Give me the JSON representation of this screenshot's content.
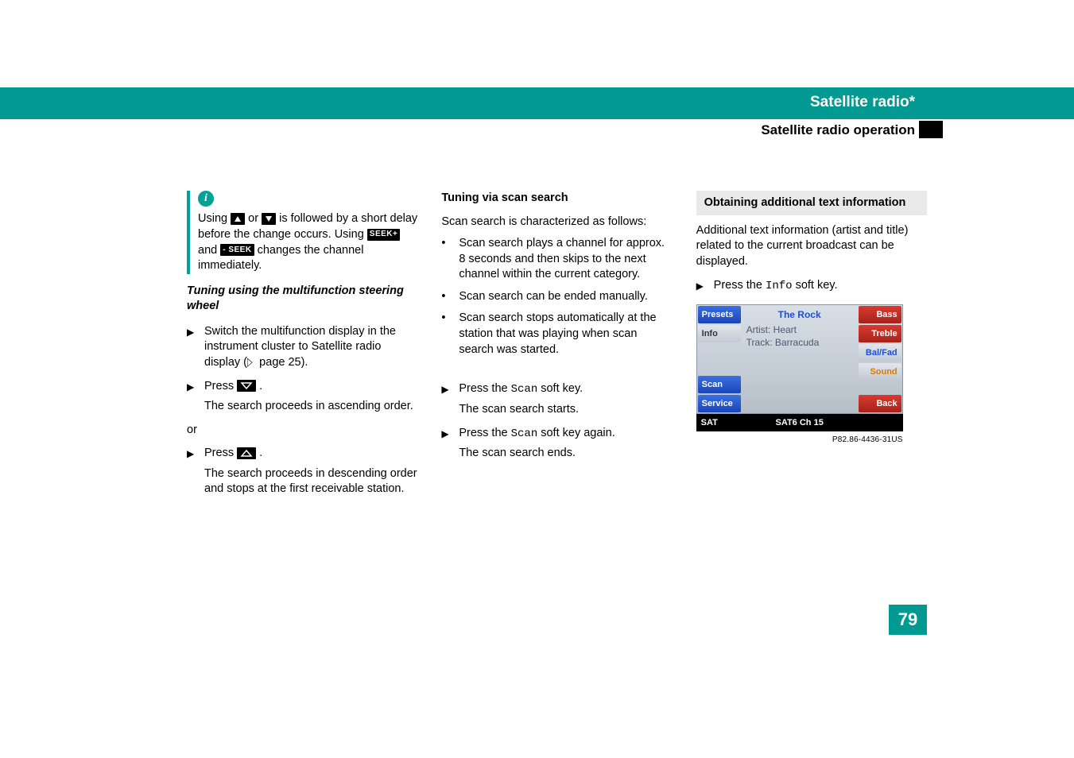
{
  "header": {
    "title": "Satellite radio*",
    "subtitle": "Satellite radio operation"
  },
  "page_number": "79",
  "col1": {
    "note_p1a": "Using ",
    "note_p1b": " or ",
    "note_p1c": "  is followed by a short delay before the change occurs.  Using ",
    "note_p1d": " and ",
    "note_p1e": " changes the channel immediately.",
    "seek_plus": "SEEK+",
    "seek_minus": "- SEEK",
    "h2": "Tuning using the multifunction steering wheel",
    "b1a": "Switch the multifunction display in the instrument cluster to Satellite radio display (",
    "b1b": " page 25).",
    "b2": "Press ",
    "b2_after": ".",
    "b2_result": "The search proceeds in ascending order.",
    "or": "or",
    "b3": "Press ",
    "b3_after": ".",
    "b3_result": "The search proceeds in descending order and stops at the first receivable station."
  },
  "col2": {
    "h1": "Tuning via scan search",
    "intro": "Scan search is characterized as follows:",
    "li1": "Scan search plays a channel for approx. 8 seconds and then skips to the next channel within the current category.",
    "li2": "Scan search can be ended manually.",
    "li3": "Scan search stops automatically at the station that was playing when scan search was started.",
    "s1a": "Press the ",
    "scan": "Scan",
    "s1b": " soft key.",
    "s1r": "The scan search starts.",
    "s2a": "Press the ",
    "s2b": " soft key again.",
    "s2r": "The scan search ends."
  },
  "col3": {
    "callout": "Obtaining additional text information",
    "p1": "Additional text information (artist and title) related to the current broadcast can be displayed.",
    "s1a": "Press the ",
    "info": "Info",
    "s1b": " soft key.",
    "img_id": "P82.86-4436-31US"
  },
  "radio": {
    "left": {
      "presets": "Presets",
      "info": "Info",
      "scan": "Scan",
      "service": "Service"
    },
    "right": {
      "bass": "Bass",
      "treble": "Treble",
      "balfad": "Bal/Fad",
      "sound": "Sound",
      "back": "Back"
    },
    "mid": {
      "category": "The Rock",
      "artist_label": "Artist:",
      "artist": "Heart",
      "track_label": "Track:",
      "track": "Barracuda"
    },
    "footer": {
      "sat": "SAT",
      "mid": "SAT6   Ch 15"
    }
  }
}
